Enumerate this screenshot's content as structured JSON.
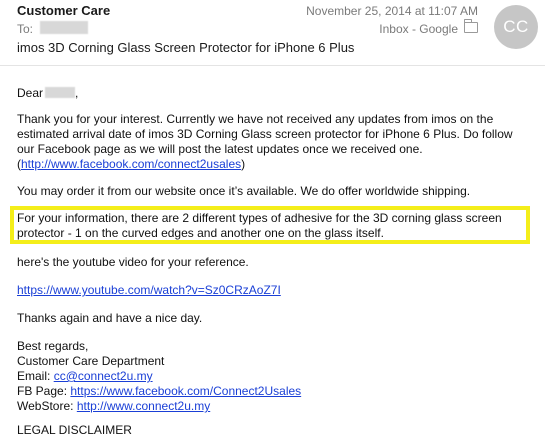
{
  "header": {
    "from": "Customer Care",
    "date": "November 25, 2014 at 11:07 AM",
    "to_label": "To:",
    "mailbox": "Inbox - Google",
    "avatar_initials": "CC",
    "subject": "imos 3D Corning Glass Screen Protector for iPhone 6 Plus"
  },
  "body": {
    "greeting": "Dear",
    "greeting_suffix": ",",
    "para1_line1": "Thank you for your interest. Currently we have not received any updates from imos on the",
    "para1_line2": "estimated arrival date of imos 3D Corning Glass screen protector for iPhone 6 Plus. Do follow",
    "para1_line3": "our Facebook page as we will post the latest updates once we received one.",
    "para1_link_prefix": "(",
    "para1_link": "http://www.facebook.com/connect2usales",
    "para1_link_suffix": ")",
    "para2": "You may order it from our website once it’s available. We do offer worldwide shipping.",
    "para3_line1": "For your information, there are 2 different types of adhesive for the 3D corning glass screen",
    "para3_line2": "protector - 1 on the curved edges and another one on the glass itself.",
    "para4": "here's the youtube video for your reference.",
    "youtube_link": "https://www.youtube.com/watch?v=Sz0CRzAoZ7I",
    "para5": "Thanks again and have a nice day.",
    "sig_regards": "Best regards,",
    "sig_dept": "Customer Care Department",
    "sig_email_label": "Email: ",
    "sig_email": "cc@connect2u.my",
    "sig_fb_label": "FB Page: ",
    "sig_fb": "https://www.facebook.com/Connect2Usales",
    "sig_web_label": "WebStore: ",
    "sig_web": "http://www.connect2u.my",
    "disclaimer": "LEGAL DISCLAIMER"
  },
  "colors": {
    "highlight": "#f4ee1a",
    "link": "#1a3fd6",
    "avatar_bg": "#c6c6c6"
  },
  "icons": [
    "folder-icon"
  ]
}
